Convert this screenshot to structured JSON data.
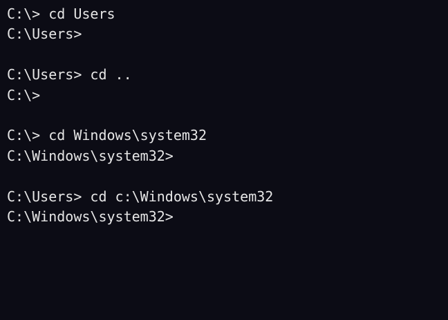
{
  "theme": {
    "background": "#0c0c15",
    "text_color": "#e6e6e6"
  },
  "console": {
    "lines": [
      "C:\\> cd Users",
      "C:\\Users>",
      "",
      "C:\\Users> cd ..",
      "C:\\>",
      "",
      "C:\\> cd Windows\\system32",
      "C:\\Windows\\system32>",
      "",
      "C:\\Users> cd c:\\Windows\\system32",
      "C:\\Windows\\system32>"
    ]
  }
}
